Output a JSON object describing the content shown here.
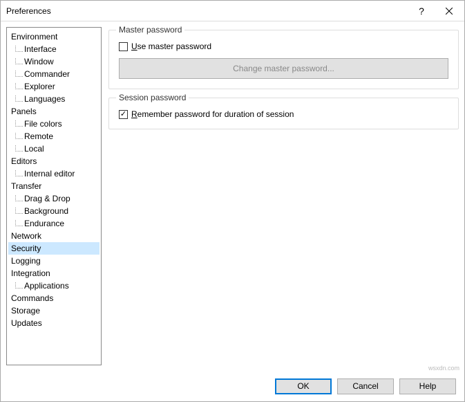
{
  "window": {
    "title": "Preferences"
  },
  "tree": {
    "items": [
      {
        "label": "Environment",
        "level": 0
      },
      {
        "label": "Interface",
        "level": 1
      },
      {
        "label": "Window",
        "level": 1
      },
      {
        "label": "Commander",
        "level": 1
      },
      {
        "label": "Explorer",
        "level": 1
      },
      {
        "label": "Languages",
        "level": 1
      },
      {
        "label": "Panels",
        "level": 0
      },
      {
        "label": "File colors",
        "level": 1
      },
      {
        "label": "Remote",
        "level": 1
      },
      {
        "label": "Local",
        "level": 1
      },
      {
        "label": "Editors",
        "level": 0
      },
      {
        "label": "Internal editor",
        "level": 1
      },
      {
        "label": "Transfer",
        "level": 0
      },
      {
        "label": "Drag & Drop",
        "level": 1
      },
      {
        "label": "Background",
        "level": 1
      },
      {
        "label": "Endurance",
        "level": 1
      },
      {
        "label": "Network",
        "level": 0
      },
      {
        "label": "Security",
        "level": 0,
        "selected": true
      },
      {
        "label": "Logging",
        "level": 0
      },
      {
        "label": "Integration",
        "level": 0
      },
      {
        "label": "Applications",
        "level": 1
      },
      {
        "label": "Commands",
        "level": 0
      },
      {
        "label": "Storage",
        "level": 0
      },
      {
        "label": "Updates",
        "level": 0
      }
    ]
  },
  "groups": {
    "master": {
      "title": "Master password",
      "checkbox_label_pre": "U",
      "checkbox_label_post": "se master password",
      "button": "Change master password..."
    },
    "session": {
      "title": "Session password",
      "checkbox_label_pre": "R",
      "checkbox_label_post": "emember password for duration of session"
    }
  },
  "footer": {
    "ok": "OK",
    "cancel": "Cancel",
    "help": "Help"
  },
  "watermark": "wsxdn.com"
}
